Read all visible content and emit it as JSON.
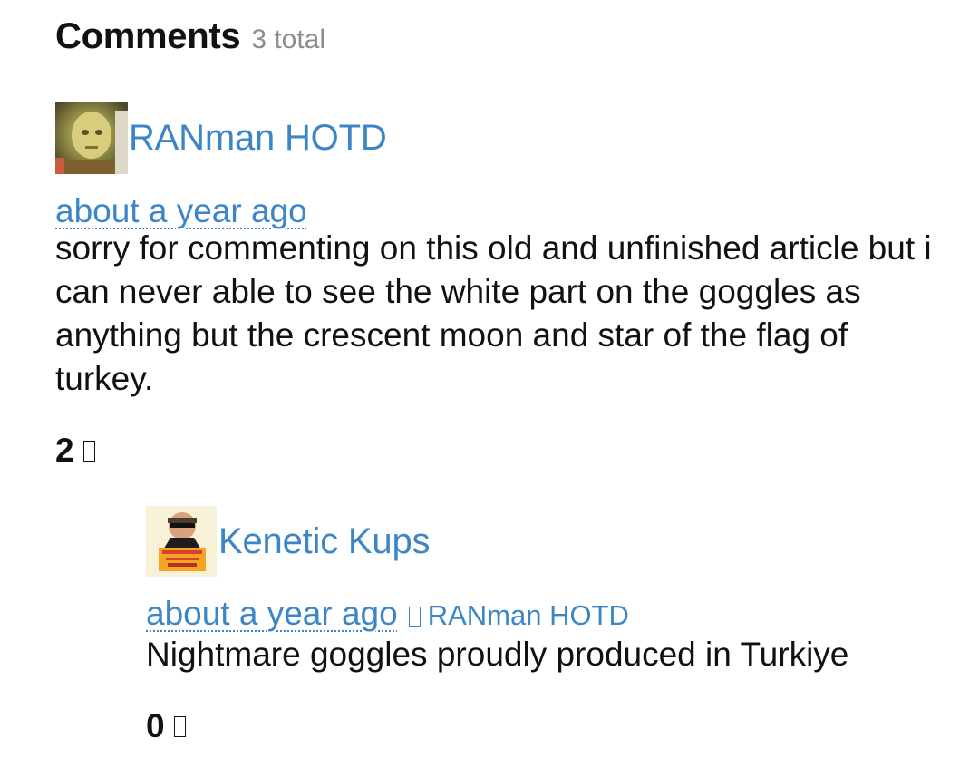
{
  "header": {
    "title": "Comments",
    "count": "3 total"
  },
  "comments": [
    {
      "author": "RANman HOTD",
      "timestamp": "about a year ago",
      "body": "sorry for commenting on this old and unfinished article but i can never able to see the white part on the goggles as anything but the crescent moon and star of the flag of turkey.",
      "votes": "2",
      "vote_icon": "vote-icon",
      "avatar_icon": "avatar"
    },
    {
      "author": "Kenetic Kups",
      "timestamp": "about a year ago",
      "reply_icon": "reply-icon",
      "reply_to": "RANman HOTD",
      "body": "Nightmare goggles proudly produced in Turkiye",
      "votes": "0",
      "vote_icon": "vote-icon",
      "avatar_icon": "avatar"
    }
  ],
  "colors": {
    "link": "#3d86c6",
    "muted": "#8d8d8d",
    "text": "#111111"
  }
}
